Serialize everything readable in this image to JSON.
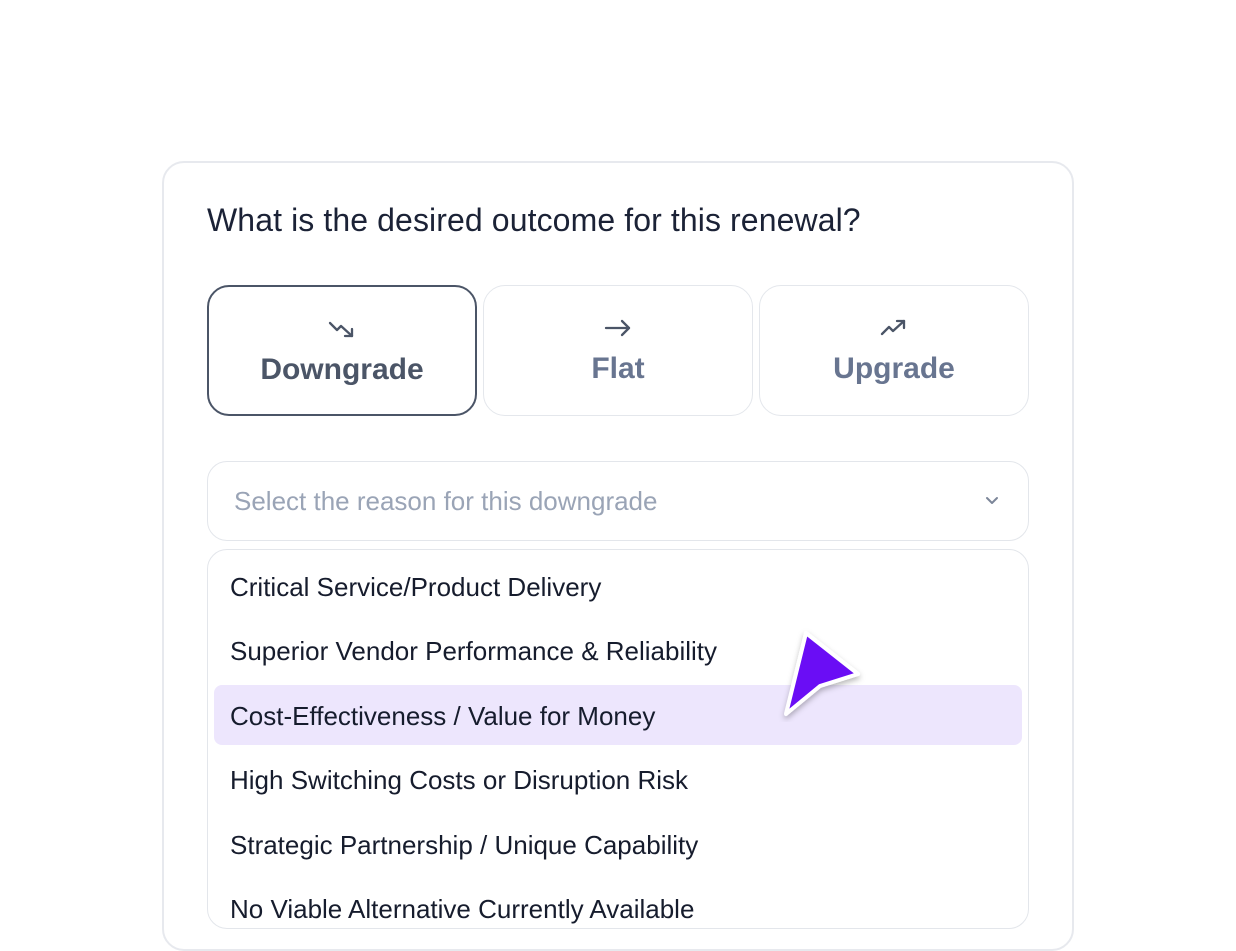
{
  "question": "What is the desired outcome for this renewal?",
  "outcome_options": [
    {
      "label": "Downgrade",
      "icon": "trending-down-icon",
      "selected": true
    },
    {
      "label": "Flat",
      "icon": "arrow-right-icon",
      "selected": false
    },
    {
      "label": "Upgrade",
      "icon": "trending-up-icon",
      "selected": false
    }
  ],
  "reason_select": {
    "placeholder": "Select the reason for this downgrade",
    "icon": "chevron-down-icon"
  },
  "reason_options": [
    {
      "label": "Critical Service/Product Delivery"
    },
    {
      "label": "Superior Vendor Performance & Reliability"
    },
    {
      "label": "Cost-Effectiveness / Value for Money",
      "highlighted": true
    },
    {
      "label": "High Switching Costs or Disruption Risk"
    },
    {
      "label": "Strategic Partnership / Unique Capability"
    },
    {
      "label": "No Viable Alternative Currently Available"
    }
  ],
  "colors": {
    "highlight": "#ede6fd",
    "cursor": "#6a0ef5",
    "text": "#161c2d",
    "muted": "#687590"
  }
}
